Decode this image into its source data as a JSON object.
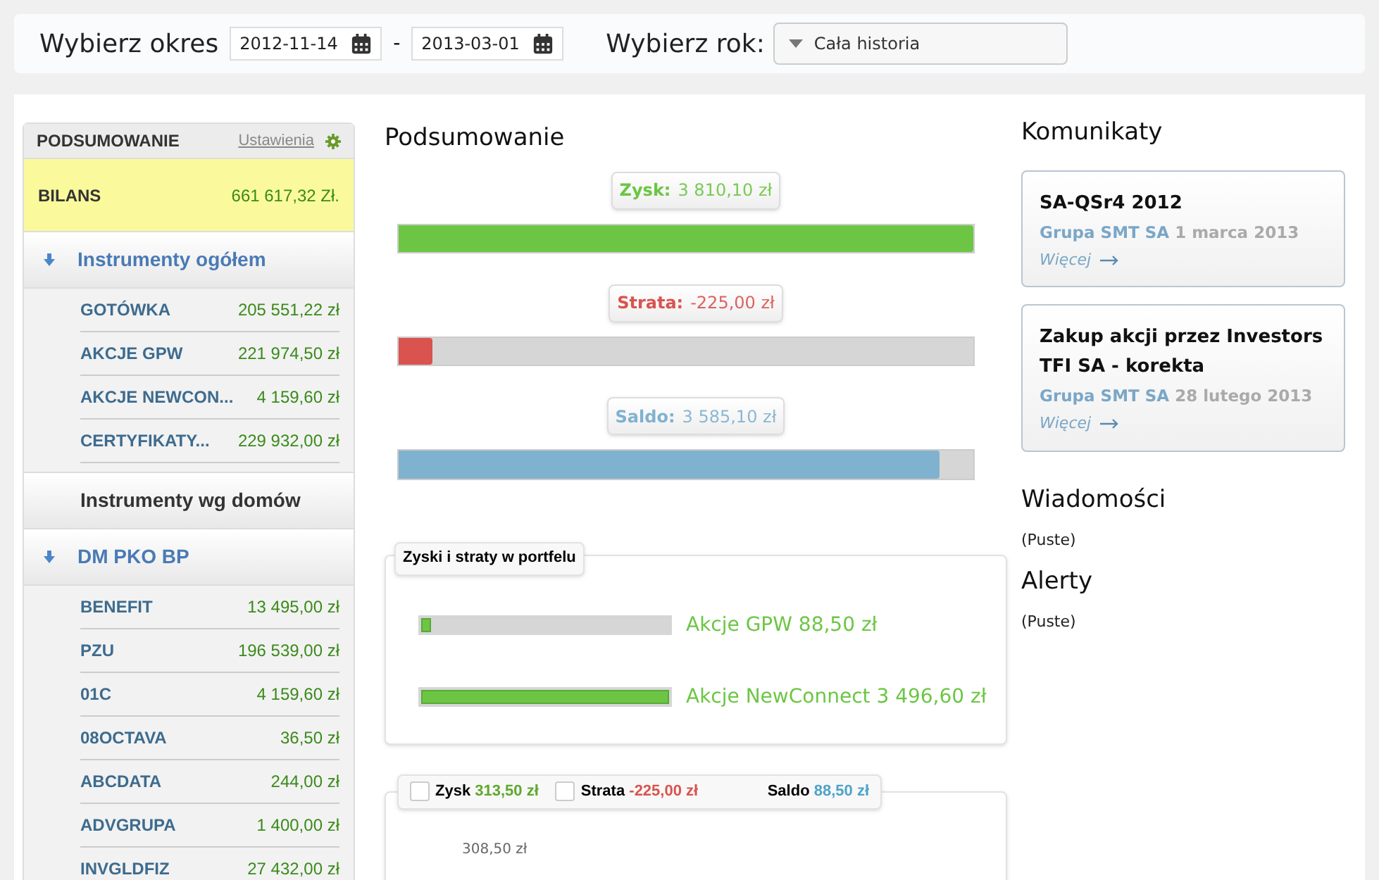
{
  "filter": {
    "period_label": "Wybierz okres",
    "date_from": "2012-11-14",
    "separator": "-",
    "date_to": "2013-03-01",
    "year_label": "Wybierz rok:",
    "year_value": "Cała historia"
  },
  "sidebar": {
    "title": "PODSUMOWANIE",
    "settings_link": "Ustawienia",
    "balance_label": "BILANS",
    "balance_value": "661 617,32 Zł.",
    "sections": [
      {
        "kind": "group",
        "label": "Instrumenty ogółem",
        "expanded": true,
        "items": [
          {
            "name": "GOTÓWKA",
            "value": "205 551,22 zł"
          },
          {
            "name": "AKCJE GPW",
            "value": "221 974,50 zł"
          },
          {
            "name": "AKCJE NEWCON...",
            "value": "4 159,60 zł"
          },
          {
            "name": "CERTYFIKATY...",
            "value": "229 932,00 zł"
          }
        ]
      },
      {
        "kind": "heading",
        "label": "Instrumenty wg domów"
      },
      {
        "kind": "group",
        "label": "DM PKO BP",
        "expanded": true,
        "items": [
          {
            "name": "BENEFIT",
            "value": "13 495,00 zł"
          },
          {
            "name": "PZU",
            "value": "196 539,00 zł"
          },
          {
            "name": "01C",
            "value": "4 159,60 zł"
          },
          {
            "name": "08OCTAVA",
            "value": "36,50 zł"
          },
          {
            "name": "ABCDATA",
            "value": "244,00 zł"
          },
          {
            "name": "ADVGRUPA",
            "value": "1 400,00 zł"
          },
          {
            "name": "INVGLDFIZ",
            "value": "27 432,00 zł"
          }
        ]
      }
    ]
  },
  "summary": {
    "title": "Podsumowanie",
    "meters": [
      {
        "label": "Zysk:",
        "value": "3 810,10 zł",
        "color": "#6cc644",
        "level": 1.0
      },
      {
        "label": "Strata:",
        "value": "-225,00 zł",
        "color": "#d9534f",
        "level": 0.06
      },
      {
        "label": "Saldo:",
        "value": "3 585,10 zł",
        "color": "#7fb2cf",
        "level": 0.94
      }
    ]
  },
  "portfolio": {
    "title": "Zyski i straty w portfelu",
    "bars": [
      {
        "label": "Akcje GPW 88,50 zł",
        "level": 0.04
      },
      {
        "label": "Akcje NewConnect 3 496,60 zł",
        "level": 1.0
      }
    ]
  },
  "legend": [
    {
      "kind": "toggle",
      "label": "Zysk",
      "value": "313,50 zł",
      "color": "#5fa82e",
      "checked": false
    },
    {
      "kind": "toggle",
      "label": "Strata",
      "value": "-225,00 zł",
      "color": "#d9534f",
      "checked": false
    },
    {
      "kind": "plain",
      "label": "Saldo",
      "value": "88,50 zł",
      "color": "#4fa3c9"
    }
  ],
  "chart_axis_label": "308,50 zł",
  "announcements": {
    "title": "Komunikaty",
    "items": [
      {
        "title": "SA-QSr4 2012",
        "source": "Grupa SMT SA",
        "date": "1 marca 2013",
        "more": "Więcej"
      },
      {
        "title": "Zakup akcji przez Investors TFI SA - korekta",
        "source": "Grupa SMT SA",
        "date": "28 lutego 2013",
        "more": "Więcej"
      }
    ]
  },
  "messages": {
    "title": "Wiadomości",
    "empty": "(Puste)"
  },
  "alerts": {
    "title": "Alerty",
    "empty": "(Puste)"
  }
}
